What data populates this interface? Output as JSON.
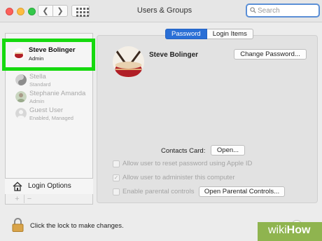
{
  "window": {
    "title": "Users & Groups"
  },
  "search": {
    "placeholder": "Search"
  },
  "users": [
    {
      "name": "Steve Bolinger",
      "role": "Admin"
    },
    {
      "name": "Stella",
      "role": "Standard"
    },
    {
      "name": "Stephanie Amanda",
      "role": "Admin"
    },
    {
      "name": "Guest User",
      "role": "Enabled, Managed"
    }
  ],
  "sidebar": {
    "login_options": "Login Options",
    "add": "+",
    "remove": "−"
  },
  "tabs": [
    {
      "label": "Password",
      "active": true
    },
    {
      "label": "Login Items",
      "active": false
    }
  ],
  "main": {
    "user_name": "Steve Bolinger",
    "change_password": "Change Password...",
    "contacts_card_label": "Contacts Card:",
    "contacts_open": "Open...",
    "checkboxes": [
      {
        "label": "Allow user to reset password using Apple ID",
        "checked": false
      },
      {
        "label": "Allow user to administer this computer",
        "checked": true
      },
      {
        "label": "Enable parental controls",
        "checked": false
      }
    ],
    "open_parental_controls": "Open Parental Controls..."
  },
  "footer": {
    "lock_text": "Click the lock to make changes.",
    "help": "?"
  },
  "watermark": {
    "wiki": "wiki",
    "how": "How"
  },
  "colors": {
    "accent": "#2a6fd6",
    "highlight": "#16d90f",
    "watermark": "#8fb44f"
  },
  "icons": [
    "back-arrow-icon",
    "forward-arrow-icon",
    "grid-icon",
    "search-icon",
    "house-icon",
    "lock-icon"
  ]
}
